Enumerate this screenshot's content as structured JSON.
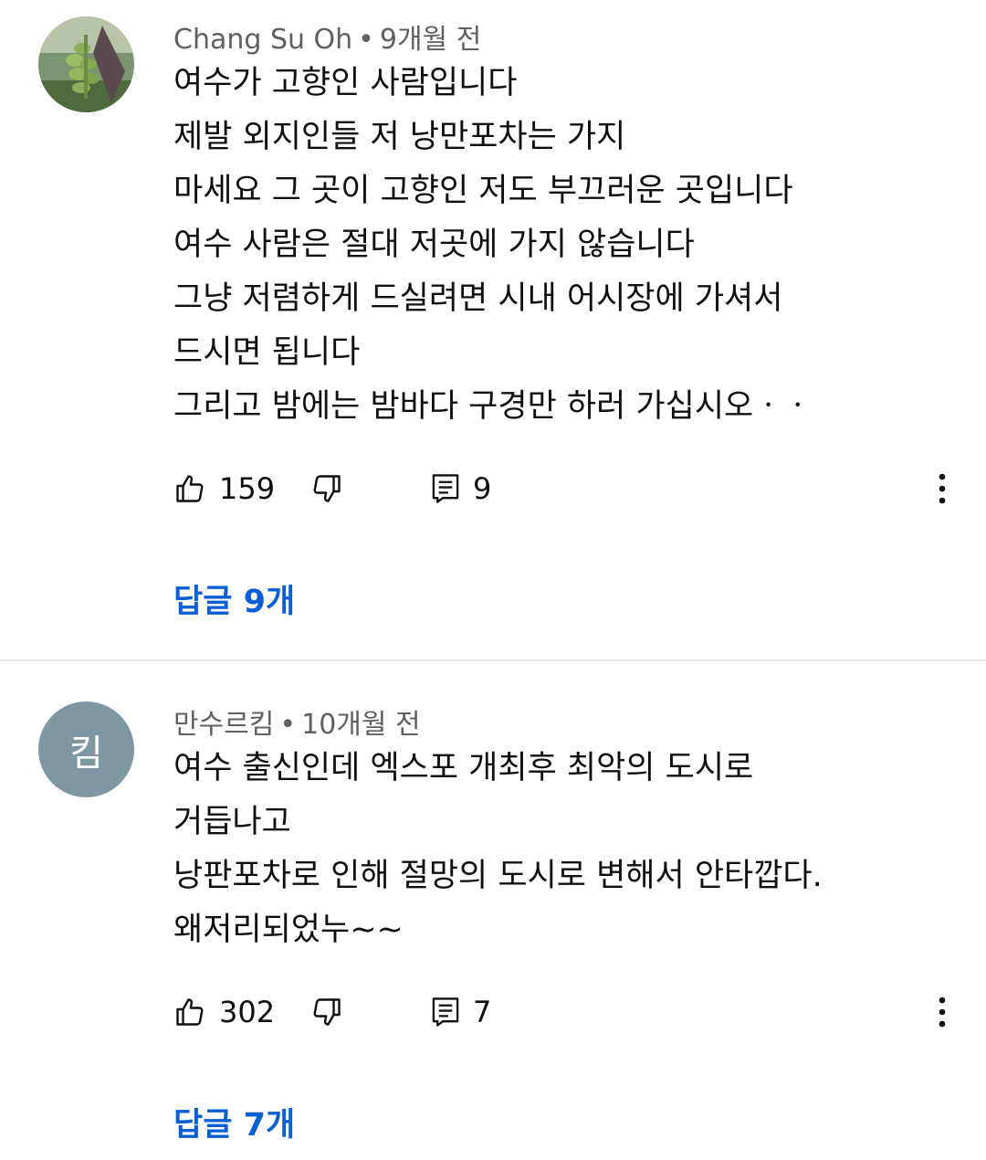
{
  "comments": [
    {
      "author": "Chang Su Oh",
      "time": "9개월 전",
      "avatar_letter": "",
      "lines": [
        "여수가 고향인 사람입니다",
        "제발 외지인들 저 낭만포차는 가지",
        "마세요 그 곳이 고향인 저도 부끄러운 곳입니다",
        "여수 사람은 절대 저곳에 가지 않습니다",
        "그냥 저렴하게 드실려면 시내 어시장에 가셔서",
        "드시면 됩니다",
        "그리고 밤에는 밤바다 구경만 하러 가십시오ㆍㆍ"
      ],
      "likes": "159",
      "reply_count": "9",
      "replies_label": "답글 9개"
    },
    {
      "author": "만수르킴",
      "time": "10개월 전",
      "avatar_letter": "킴",
      "lines": [
        "여수 출신인데 엑스포 개최후 최악의 도시로",
        "거듭나고",
        "낭판포차로 인해 절망의 도시로 변해서 안타깝다.",
        "왜저리되었누~~"
      ],
      "likes": "302",
      "reply_count": "7",
      "replies_label": "답글 7개"
    }
  ],
  "icons": {
    "like": "thumbs-up-icon",
    "dislike": "thumbs-down-icon",
    "reply": "comment-icon",
    "more": "more-vert-icon"
  },
  "colors": {
    "link": "#065fd4",
    "meta": "#606060",
    "avatar_bg": "#7d97a3"
  }
}
